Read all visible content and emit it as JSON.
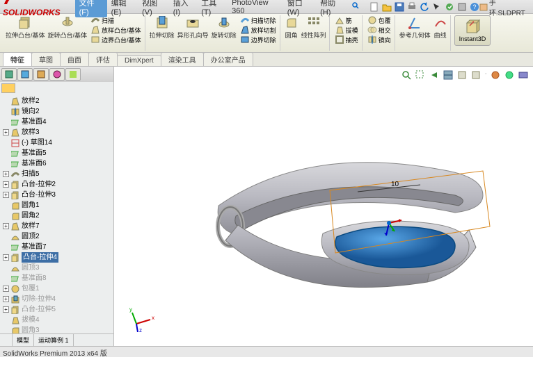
{
  "app": {
    "brand": "SOLIDWORKS",
    "filename": "手环.SLDPRT"
  },
  "menu": {
    "file": "文件(F)",
    "items": [
      "编辑(E)",
      "视图(V)",
      "插入(I)",
      "工具(T)",
      "PhotoView 360",
      "窗口(W)",
      "帮助(H)"
    ]
  },
  "ribbon": {
    "g1": {
      "a": "拉伸凸台/基体",
      "b": "旋转凸台/基体",
      "c1": "扫描",
      "c2": "放样凸台/基体",
      "c3": "边界凸台/基体"
    },
    "g2": {
      "a": "拉伸切除",
      "b": "异形孔向导",
      "c": "旋转切除",
      "d1": "扫描切除",
      "d2": "放样切割",
      "d3": "边界切除"
    },
    "g3": {
      "a": "圆角",
      "b": "线性阵列"
    },
    "g4": {
      "a": "筋",
      "b": "拔模",
      "c": "抽壳",
      "d": "包覆",
      "e": "相交",
      "f": "镜向"
    },
    "g5": {
      "a": "参考几何体",
      "b": "曲线"
    },
    "instant3d": "Instant3D"
  },
  "tabs": [
    "特征",
    "草图",
    "曲面",
    "评估",
    "DimXpert",
    "渲染工具",
    "办公室产品"
  ],
  "tree": [
    {
      "exp": "",
      "ic": "loft",
      "txt": "放样2"
    },
    {
      "exp": "",
      "ic": "mirror",
      "txt": "镜向2"
    },
    {
      "exp": "",
      "ic": "plane",
      "txt": "基准面4"
    },
    {
      "exp": "+",
      "ic": "loft",
      "txt": "放样3"
    },
    {
      "exp": "",
      "ic": "sketch",
      "txt": "(-) 草图14"
    },
    {
      "exp": "",
      "ic": "plane",
      "txt": "基准面5"
    },
    {
      "exp": "",
      "ic": "plane",
      "txt": "基准面6"
    },
    {
      "exp": "+",
      "ic": "sweep",
      "txt": "扫描5"
    },
    {
      "exp": "+",
      "ic": "extr",
      "txt": "凸台-拉伸2"
    },
    {
      "exp": "+",
      "ic": "extr",
      "txt": "凸台-拉伸3"
    },
    {
      "exp": "",
      "ic": "fillet",
      "txt": "圆角1"
    },
    {
      "exp": "",
      "ic": "fillet",
      "txt": "圆角2"
    },
    {
      "exp": "+",
      "ic": "loft",
      "txt": "放样7"
    },
    {
      "exp": "",
      "ic": "dome",
      "txt": "圆顶2"
    },
    {
      "exp": "",
      "ic": "plane",
      "txt": "基准面7"
    },
    {
      "exp": "+",
      "ic": "extr",
      "txt": "凸台-拉伸4",
      "sel": true
    },
    {
      "exp": "",
      "ic": "dome",
      "txt": "圆顶3",
      "dim": true
    },
    {
      "exp": "",
      "ic": "plane",
      "txt": "基准面8",
      "dim": true
    },
    {
      "exp": "+",
      "ic": "wrap",
      "txt": "包覆1",
      "dim": true
    },
    {
      "exp": "+",
      "ic": "cut",
      "txt": "切除-拉伸4",
      "dim": true
    },
    {
      "exp": "+",
      "ic": "extr",
      "txt": "凸台-拉伸5",
      "dim": true
    },
    {
      "exp": "",
      "ic": "draft",
      "txt": "拔模4",
      "dim": true
    },
    {
      "exp": "",
      "ic": "fillet",
      "txt": "圆角3",
      "dim": true
    }
  ],
  "lp_bottom": [
    "模型",
    "运动算例 1"
  ],
  "vp_dim": "10",
  "status": "SolidWorks Premium 2013 x64 版"
}
